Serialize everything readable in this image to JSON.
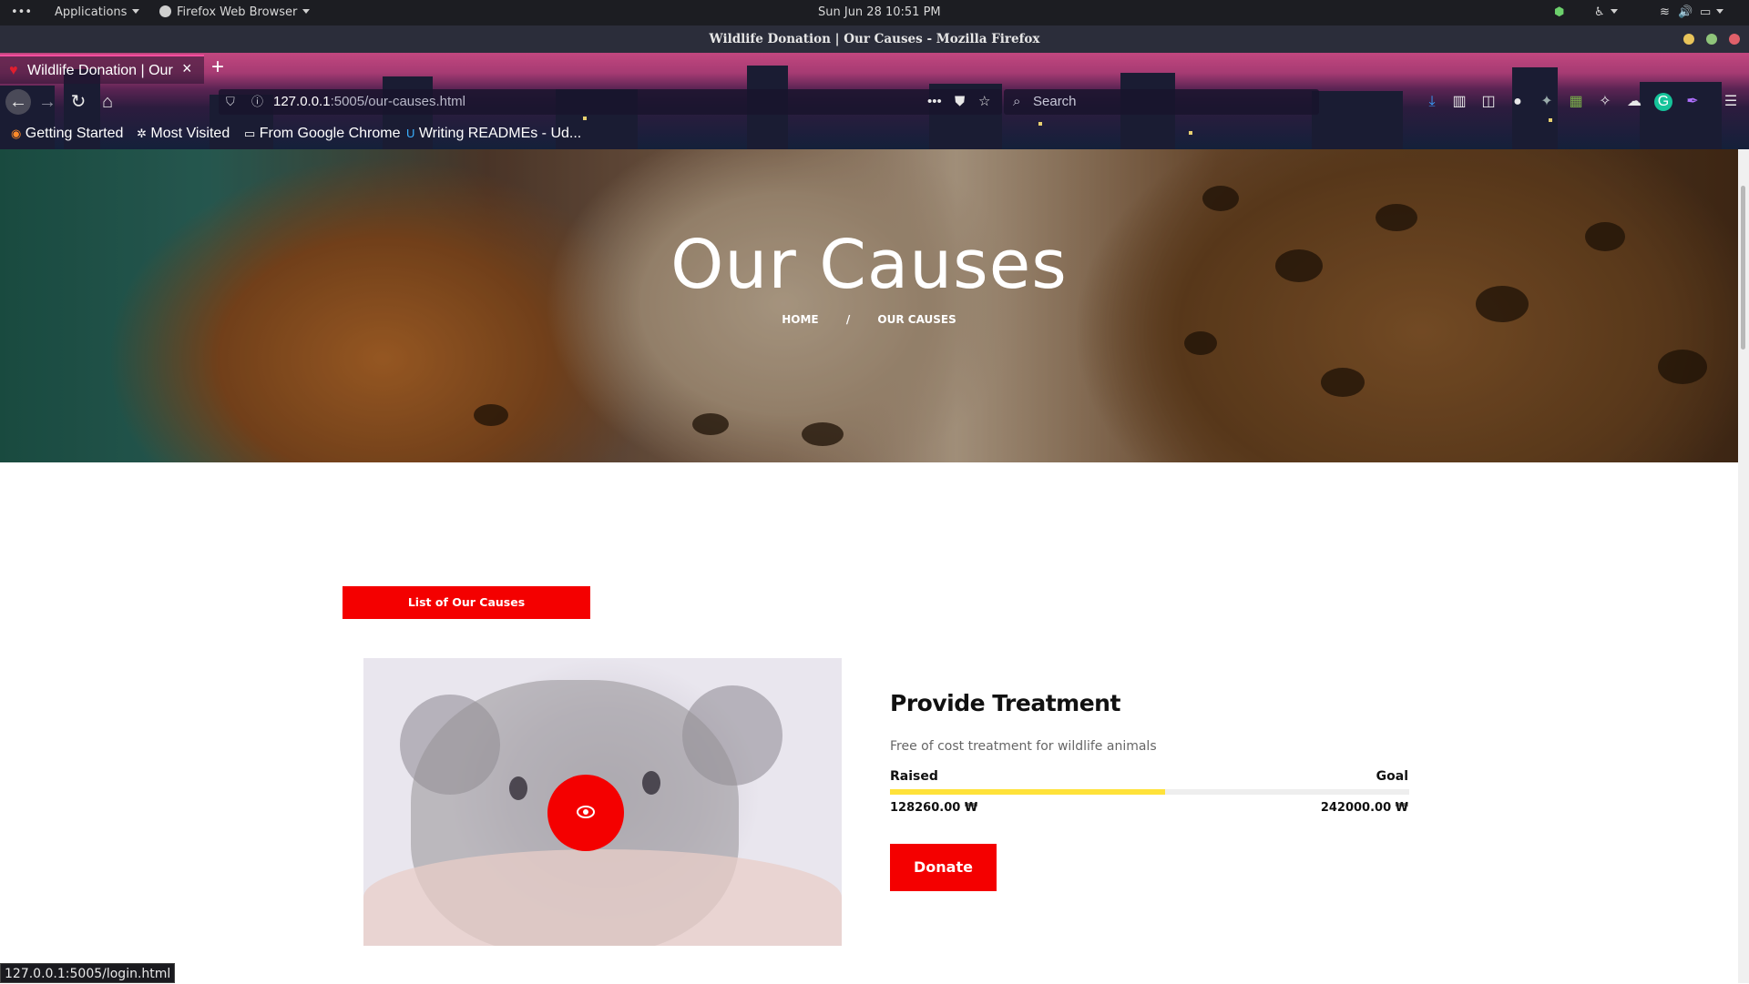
{
  "system_bar": {
    "dots": "•••",
    "applications": "Applications",
    "active_app": "Firefox Web Browser",
    "datetime": "Sun Jun 28  10:51 PM"
  },
  "window": {
    "title": "Wildlife Donation | Our Causes - Mozilla Firefox"
  },
  "browser": {
    "tab_title": "Wildlife Donation | Our",
    "url_host": "127.0.0.1",
    "url_rest": ":5005/our-causes.html",
    "search_placeholder": "Search",
    "bookmarks": [
      {
        "label": "Getting Started"
      },
      {
        "label": "Most Visited"
      },
      {
        "label": "From Google Chrome"
      },
      {
        "label": "Writing READMEs - Ud..."
      }
    ]
  },
  "hero": {
    "title": "Our Causes",
    "breadcrumb_home": "HOME",
    "breadcrumb_separator": "/",
    "breadcrumb_current": "OUR CAUSES"
  },
  "section": {
    "list_button": "List of Our Causes"
  },
  "cause": {
    "title": "Provide Treatment",
    "description": "Free of cost treatment for wildlife animals",
    "raised_label": "Raised",
    "goal_label": "Goal",
    "raised_amount": "128260.00 ₩",
    "goal_amount": "242000.00 ₩",
    "progress_fraction": 0.53,
    "donate_label": "Donate"
  },
  "status_bar": {
    "link": "127.0.0.1:5005/login.html"
  },
  "colors": {
    "accent_red": "#f40000",
    "progress_yellow": "#ffe23a"
  }
}
